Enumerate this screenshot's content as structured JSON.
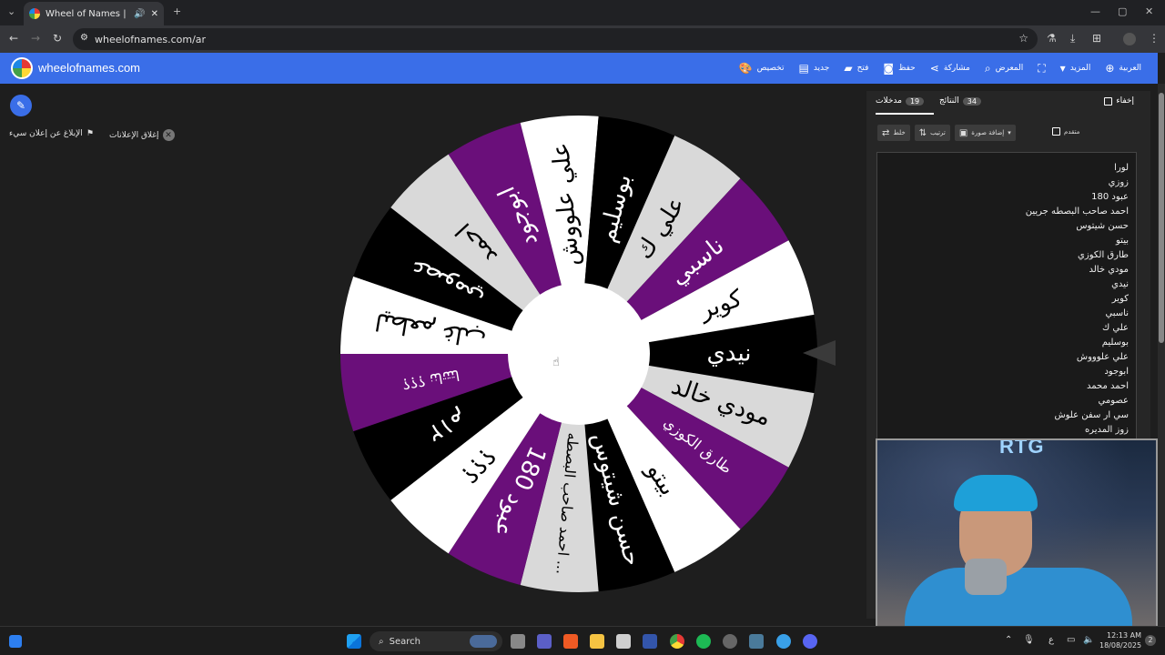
{
  "browser": {
    "tab_title": "Wheel of Names | العشوائي",
    "new_tab": "+",
    "url": "wheelofnames.com/ar",
    "win_min": "—",
    "win_max": "▢",
    "win_close": "✕"
  },
  "header": {
    "brand": "wheelofnames.com",
    "menu": [
      {
        "label": "تخصيص",
        "icon": "palette-icon",
        "glyph": "🎨"
      },
      {
        "label": "جديد",
        "icon": "file-icon",
        "glyph": "▤"
      },
      {
        "label": "فتح",
        "icon": "folder-icon",
        "glyph": "▰"
      },
      {
        "label": "حفظ",
        "icon": "save-icon",
        "glyph": "◙"
      },
      {
        "label": "مشاركة",
        "icon": "share-icon",
        "glyph": "⋖"
      },
      {
        "label": "المعرض",
        "icon": "search-icon",
        "glyph": "⌕"
      },
      {
        "label": "",
        "icon": "fullscreen-icon",
        "glyph": "⛶"
      },
      {
        "label": "المزيد",
        "icon": "chevron-down-icon",
        "glyph": "▾"
      },
      {
        "label": "العربية",
        "icon": "globe-icon",
        "glyph": "⊕"
      }
    ]
  },
  "ads": {
    "close_ads": "إغلاق الإعلانات",
    "report_ad": "الإبلاغ عن إعلان سيء"
  },
  "wheel": {
    "slices": [
      {
        "label": "نيدي",
        "color": "#000000"
      },
      {
        "label": "مودي خالد",
        "color": "#d9d9d9"
      },
      {
        "label": "طارق الكوزي",
        "color": "#6a0f7a"
      },
      {
        "label": "بيتو",
        "color": "#ffffff"
      },
      {
        "label": "حسن شيتوس",
        "color": "#000000"
      },
      {
        "label": "احمد صاحب البصطه ...",
        "color": "#d9d9d9"
      },
      {
        "label": "عبود 180",
        "color": "#6a0f7a"
      },
      {
        "label": "؟؟؟",
        "color": "#ffffff"
      },
      {
        "label": "١٢م",
        "color": "#000000"
      },
      {
        "label": "؟؟؟ نناتتتا",
        "color": "#6a0f7a"
      },
      {
        "label": "ليطعم غلب",
        "color": "#ffffff"
      },
      {
        "label": "عصومي",
        "color": "#000000"
      },
      {
        "label": "احمد",
        "color": "#d9d9d9"
      },
      {
        "label": "ابوجود",
        "color": "#6a0f7a"
      },
      {
        "label": "علي علووش",
        "color": "#ffffff"
      },
      {
        "label": "بوسليم",
        "color": "#000000"
      },
      {
        "label": "علي ك",
        "color": "#d9d9d9"
      },
      {
        "label": "ناسبي",
        "color": "#6a0f7a"
      },
      {
        "label": "كوير",
        "color": "#ffffff"
      }
    ]
  },
  "panel": {
    "tab_entries": "مدخلات",
    "entries_count": "19",
    "tab_results": "النتائج",
    "results_count": "34",
    "hide": "إخفاء",
    "shuffle": "خلط",
    "sort": "ترتيب",
    "add_image": "إضافة صورة",
    "advanced": "متقدم",
    "entries": [
      "لورا",
      "زوزي",
      "عبود 180",
      "احمد صاحب البصطه جريين",
      "حسن شيتوس",
      "بيتو",
      "طارق الكوزي",
      "مودي خالد",
      "نيدي",
      "كوير",
      "ناسبي",
      "علي ك",
      "بوسليم",
      "علي علوووش",
      "ابوجود",
      "احمد محمد",
      "عصومي",
      "سي ار سفن علوش",
      "زوز المديره"
    ]
  },
  "webcam": {
    "logo": "RTG"
  },
  "taskbar": {
    "search": "Search",
    "lang": "ع",
    "time": "12:13 AM",
    "date": "18/08/2025",
    "notif": "2"
  },
  "colors": {
    "brand_blue": "#3a6ee8",
    "purple": "#6a0f7a"
  }
}
